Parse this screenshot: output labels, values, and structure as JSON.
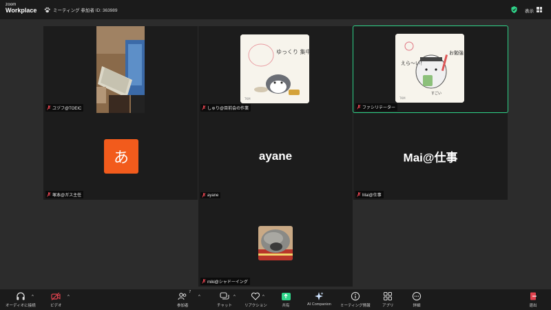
{
  "app": {
    "logo_small": "zoom",
    "logo_big": "Workplace"
  },
  "meeting": {
    "info": "ミーティング 参加者 ID: 363989"
  },
  "topbar": {
    "view_label": "表示"
  },
  "tiles": [
    {
      "name": "ユヅフ@TOEIC",
      "type": "video"
    },
    {
      "name": "しゅり@目前会の作業",
      "type": "sticker"
    },
    {
      "name": "ファシリテーター",
      "type": "sticker",
      "active": true,
      "sticker_text": "お勉強して えら〜い！",
      "sticker_sub": "すごい"
    },
    {
      "name": "塚本@ガス主任",
      "type": "avatar",
      "avatar_char": "あ",
      "avatar_color": "#f25b1c"
    },
    {
      "name": "ayane",
      "type": "name",
      "display": "ayane"
    },
    {
      "name": "Mai@仕事",
      "type": "name",
      "display": "Mai@仕事"
    },
    {
      "name": "miki@シャドーイング",
      "type": "photo"
    }
  ],
  "sticker1": {
    "text1": "ゆっくり 集中して",
    "text2": "えらい！"
  },
  "toolbar": {
    "audio": "オーディオに接続",
    "video": "ビデオ",
    "participants": "参加者",
    "participants_count": "7",
    "chat": "チャット",
    "reactions": "リアクション",
    "share": "共有",
    "ai": "AI Companion",
    "meeting_info": "ミーティング情報",
    "apps": "アプリ",
    "more": "詳細",
    "leave": "退出"
  },
  "colors": {
    "accent": "#2fd58a",
    "danger": "#e0424e",
    "avatar": "#f25b1c"
  }
}
